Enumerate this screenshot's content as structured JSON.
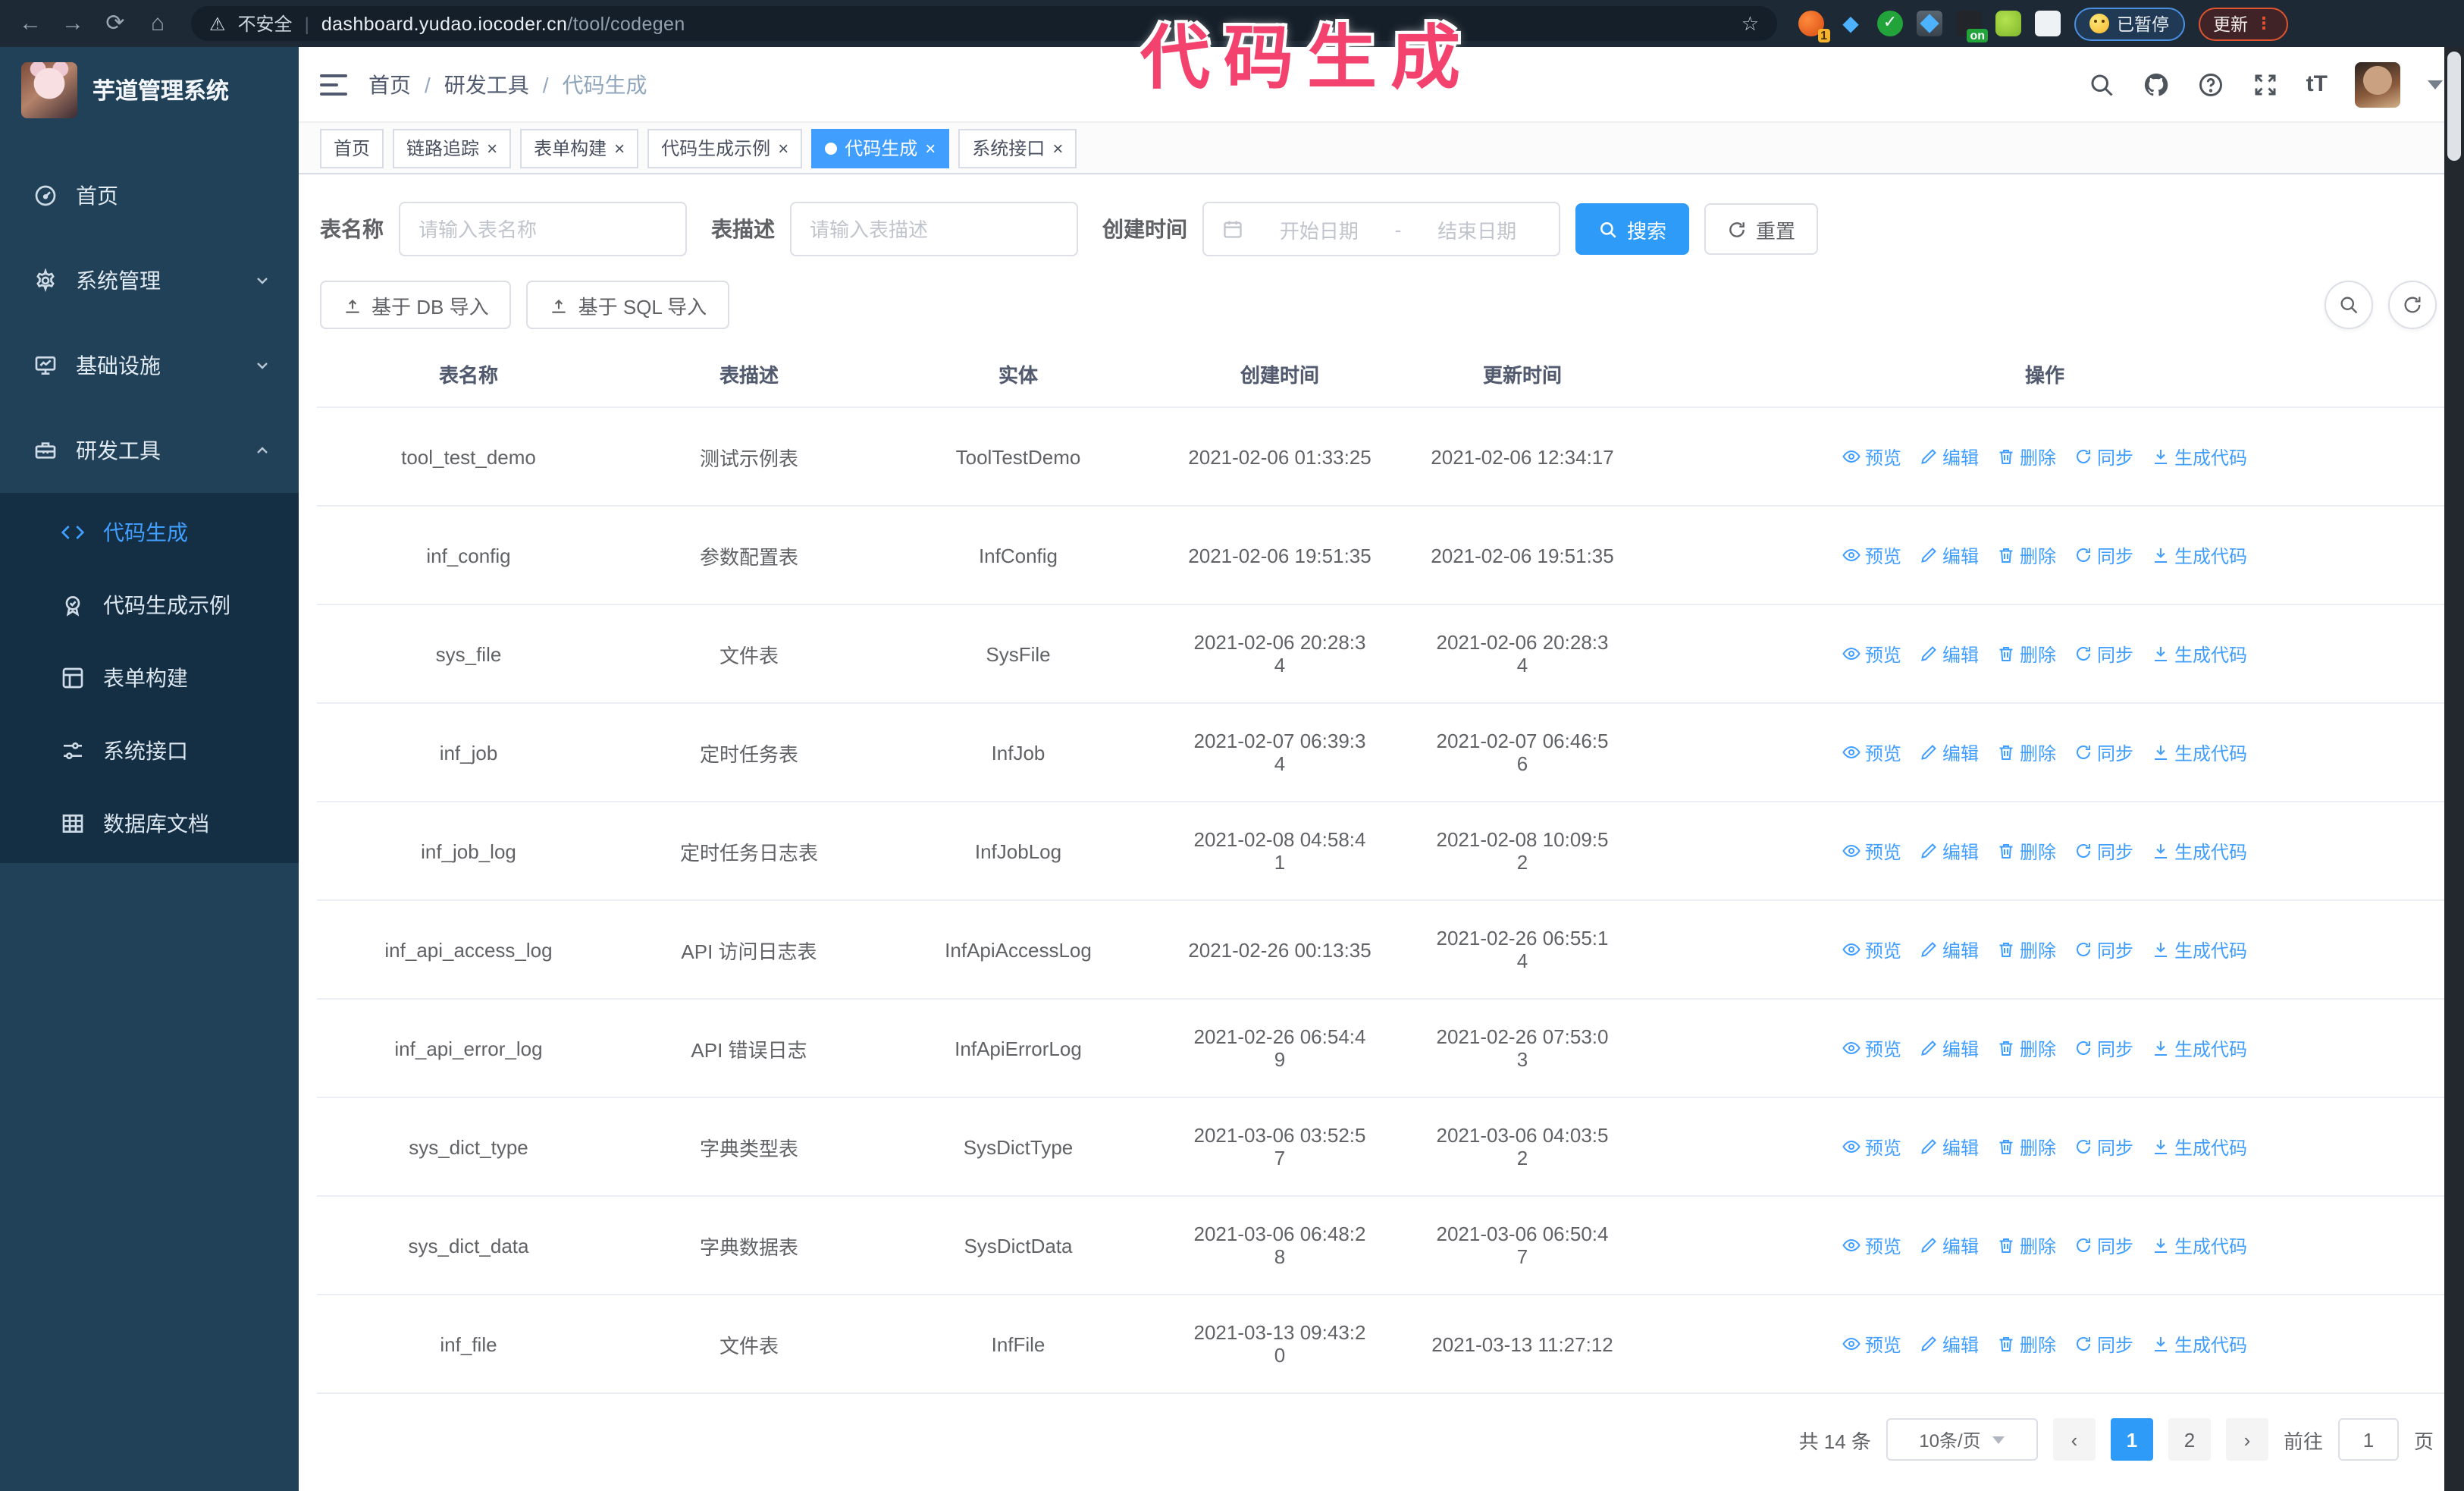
{
  "browser": {
    "security_label": "不安全",
    "url_domain": "dashboard.yudao.iocoder.cn",
    "url_path": "/tool/codegen",
    "extension_badge": "1",
    "extension_on_badge": "on",
    "paused_label": "已暂停",
    "update_label": "更新",
    "update_dots": "⋮"
  },
  "annotation": {
    "text": "代码生成",
    "color": "#f4426e"
  },
  "sidebar": {
    "title": "芋道管理系统",
    "items": [
      {
        "label": "首页",
        "icon": "dashboard-icon",
        "group": false
      },
      {
        "label": "系统管理",
        "icon": "gear-icon",
        "group": true,
        "chevron": "down"
      },
      {
        "label": "基础设施",
        "icon": "monitor-icon",
        "group": true,
        "chevron": "down"
      },
      {
        "label": "研发工具",
        "icon": "toolbox-icon",
        "group": true,
        "chevron": "up",
        "expanded": true
      }
    ],
    "submenu": [
      {
        "label": "代码生成",
        "icon": "code-icon",
        "active": true
      },
      {
        "label": "代码生成示例",
        "icon": "badge-check-icon",
        "active": false
      },
      {
        "label": "表单构建",
        "icon": "form-icon",
        "active": false
      },
      {
        "label": "系统接口",
        "icon": "sliders-icon",
        "active": false
      },
      {
        "label": "数据库文档",
        "icon": "db-table-icon",
        "active": false
      }
    ]
  },
  "navbar": {
    "breadcrumb": [
      "首页",
      "研发工具",
      "代码生成"
    ],
    "separator": "/"
  },
  "tabs": [
    {
      "label": "首页",
      "closable": false,
      "active": false
    },
    {
      "label": "链路追踪",
      "closable": true,
      "active": false
    },
    {
      "label": "表单构建",
      "closable": true,
      "active": false
    },
    {
      "label": "代码生成示例",
      "closable": true,
      "active": false
    },
    {
      "label": "代码生成",
      "closable": true,
      "active": true
    },
    {
      "label": "系统接口",
      "closable": true,
      "active": false
    }
  ],
  "filters": {
    "name_label": "表名称",
    "name_placeholder": "请输入表名称",
    "desc_label": "表描述",
    "desc_placeholder": "请输入表描述",
    "time_label": "创建时间",
    "start_placeholder": "开始日期",
    "range_separator": "-",
    "end_placeholder": "结束日期",
    "search_label": "搜索",
    "reset_label": "重置"
  },
  "toolbar": {
    "import_db_label": "基于 DB 导入",
    "import_sql_label": "基于 SQL 导入"
  },
  "table": {
    "headers": [
      "表名称",
      "表描述",
      "实体",
      "创建时间",
      "更新时间",
      "操作"
    ],
    "actions": [
      {
        "label": "预览",
        "icon": "eye-icon"
      },
      {
        "label": "编辑",
        "icon": "edit-icon"
      },
      {
        "label": "删除",
        "icon": "delete-icon"
      },
      {
        "label": "同步",
        "icon": "sync-icon"
      },
      {
        "label": "生成代码",
        "icon": "download-icon"
      }
    ],
    "rows": [
      {
        "name": "tool_test_demo",
        "desc": "测试示例表",
        "entity": "ToolTestDemo",
        "created": "2021-02-06 01:33:25",
        "updated": "2021-02-06 12:34:17"
      },
      {
        "name": "inf_config",
        "desc": "参数配置表",
        "entity": "InfConfig",
        "created": "2021-02-06 19:51:35",
        "updated": "2021-02-06 19:51:35"
      },
      {
        "name": "sys_file",
        "desc": "文件表",
        "entity": "SysFile",
        "created": "2021-02-06 20:28:3\n4",
        "updated": "2021-02-06 20:28:3\n4"
      },
      {
        "name": "inf_job",
        "desc": "定时任务表",
        "entity": "InfJob",
        "created": "2021-02-07 06:39:3\n4",
        "updated": "2021-02-07 06:46:5\n6"
      },
      {
        "name": "inf_job_log",
        "desc": "定时任务日志表",
        "entity": "InfJobLog",
        "created": "2021-02-08 04:58:4\n1",
        "updated": "2021-02-08 10:09:5\n2"
      },
      {
        "name": "inf_api_access_log",
        "desc": "API 访问日志表",
        "entity": "InfApiAccessLog",
        "created": "2021-02-26 00:13:35",
        "updated": "2021-02-26 06:55:1\n4"
      },
      {
        "name": "inf_api_error_log",
        "desc": "API 错误日志",
        "entity": "InfApiErrorLog",
        "created": "2021-02-26 06:54:4\n9",
        "updated": "2021-02-26 07:53:0\n3"
      },
      {
        "name": "sys_dict_type",
        "desc": "字典类型表",
        "entity": "SysDictType",
        "created": "2021-03-06 03:52:5\n7",
        "updated": "2021-03-06 04:03:5\n2"
      },
      {
        "name": "sys_dict_data",
        "desc": "字典数据表",
        "entity": "SysDictData",
        "created": "2021-03-06 06:48:2\n8",
        "updated": "2021-03-06 06:50:4\n7"
      },
      {
        "name": "inf_file",
        "desc": "文件表",
        "entity": "InfFile",
        "created": "2021-03-13 09:43:2\n0",
        "updated": "2021-03-13 11:27:12"
      }
    ]
  },
  "pagination": {
    "total_label": "共 14 条",
    "page_size": "10条/页",
    "pages": [
      "1",
      "2"
    ],
    "active_page": "1",
    "goto_label": "前往",
    "goto_value": "1",
    "goto_suffix": "页"
  },
  "colors": {
    "accent": "#409eff",
    "annotation_pink": "#f4426e",
    "sidebar_bg": "#214158",
    "submenu_bg": "#142e44",
    "browser_bar": "#1d2935"
  }
}
